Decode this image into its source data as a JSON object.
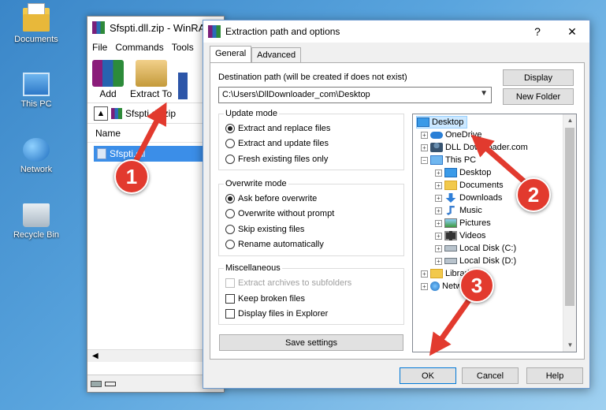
{
  "desktop": {
    "icons": [
      {
        "label": "Documents"
      },
      {
        "label": "This PC"
      },
      {
        "label": "Network"
      },
      {
        "label": "Recycle Bin"
      }
    ]
  },
  "winrar": {
    "title": "Sfspti.dll.zip - WinRAR",
    "menu": [
      "File",
      "Commands",
      "Tools"
    ],
    "toolbar": {
      "add_label": "Add",
      "extract_label": "Extract To"
    },
    "path": "Sfspti.dll.zip",
    "column_name": "Name",
    "selected_file": "Sfspti.dll"
  },
  "dialog": {
    "title": "Extraction path and options",
    "help_glyph": "?",
    "close_glyph": "✕",
    "tabs": {
      "general": "General",
      "advanced": "Advanced"
    },
    "destination_label": "Destination path (will be created if does not exist)",
    "destination_value": "C:\\Users\\DllDownloader_com\\Desktop",
    "display_button": "Display",
    "new_folder_button": "New Folder",
    "update_mode": {
      "title": "Update mode",
      "options": [
        "Extract and replace files",
        "Extract and update files",
        "Fresh existing files only"
      ],
      "selected": 0
    },
    "overwrite_mode": {
      "title": "Overwrite mode",
      "options": [
        "Ask before overwrite",
        "Overwrite without prompt",
        "Skip existing files",
        "Rename automatically"
      ],
      "selected": 0
    },
    "misc": {
      "title": "Miscellaneous",
      "options": [
        "Extract archives to subfolders",
        "Keep broken files",
        "Display files in Explorer"
      ]
    },
    "save_settings": "Save settings",
    "tree": {
      "items": [
        "Desktop",
        "OneDrive",
        "DLL Downloader.com",
        "This PC",
        "Desktop",
        "Documents",
        "Downloads",
        "Music",
        "Pictures",
        "Videos",
        "Local Disk (C:)",
        "Local Disk (D:)",
        "Libraries",
        "Network"
      ]
    },
    "ok": "OK",
    "cancel": "Cancel",
    "help": "Help"
  },
  "annotations": {
    "step1": "1",
    "step2": "2",
    "step3": "3",
    "color": "#e23a2e"
  }
}
